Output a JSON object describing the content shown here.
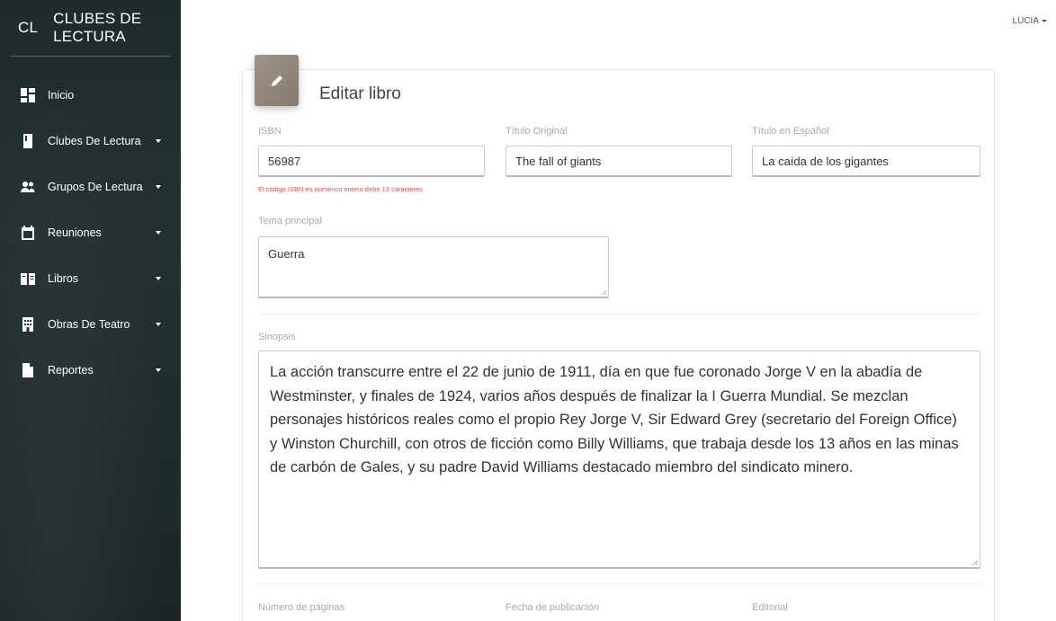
{
  "sidebar": {
    "brand_abbr": "CL",
    "brand_name": "CLUBES DE LECTURA",
    "items": [
      {
        "label": "Inicio",
        "icon": "dashboard-icon",
        "has_caret": false
      },
      {
        "label": "Clubes De Lectura",
        "icon": "book-icon",
        "has_caret": true
      },
      {
        "label": "Grupos De Lectura",
        "icon": "people-icon",
        "has_caret": true
      },
      {
        "label": "Reuniones",
        "icon": "calendar-icon",
        "has_caret": true
      },
      {
        "label": "Libros",
        "icon": "open-book-icon",
        "has_caret": true
      },
      {
        "label": "Obras De Teatro",
        "icon": "building-icon",
        "has_caret": true
      },
      {
        "label": "Reportes",
        "icon": "file-icon",
        "has_caret": true
      }
    ]
  },
  "header": {
    "user": "LUCIA"
  },
  "form": {
    "title": "Editar libro",
    "header_icon": "pencil-icon",
    "isbn": {
      "label": "ISBN",
      "value": "56987",
      "error": "El código ISBN es numérico entero debe 13 caracteres"
    },
    "original_title": {
      "label": "Título Original",
      "value": "The fall of giants"
    },
    "spanish_title": {
      "label": "Título en Español",
      "value": "La caída de los gigantes"
    },
    "main_theme": {
      "label": "Tema principal",
      "value": "Guerra"
    },
    "synopsis": {
      "label": "Sinopsis",
      "value": "La acción transcurre entre el 22 de junio de 1911, día en que fue coronado Jorge V en la abadía de Westminster, y finales de 1924, varios años después de finalizar la I Guerra Mundial. Se mezclan personajes históricos reales como el propio Rey Jorge V, Sir Edward Grey (secretario del Foreign Office) y Winston Churchill, con otros de ficción como Billy Williams, que trabaja desde los 13 años en las minas de carbón de Gales, y su padre David Williams destacado miembro del sindicato minero."
    },
    "pages": {
      "label": "Número de páginas"
    },
    "publication_date": {
      "label": "Fecha de publicación"
    },
    "publisher": {
      "label": "Editorial"
    }
  }
}
